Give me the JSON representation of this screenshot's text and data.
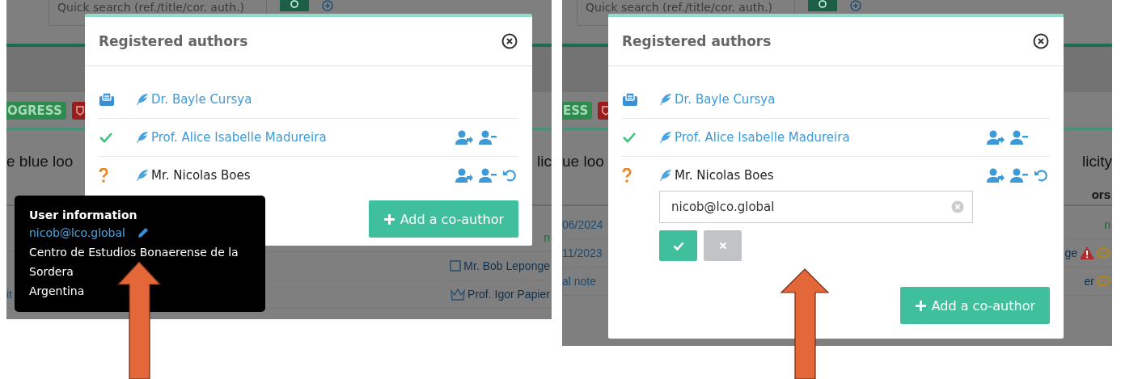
{
  "panels": [
    {
      "backdrop": {
        "search_placeholder": "Quick search (ref./title/cor. auth.)",
        "badges": [
          {
            "kind": "text",
            "text": "OGRESS",
            "color": "#2e8b4f"
          },
          {
            "kind": "icon",
            "color": "#9b1c1c"
          }
        ],
        "heading_left": "e blue loo",
        "heading_right": "lic",
        "rows": [
          {
            "right": "n",
            "kind": "green",
            "icons": []
          },
          {
            "right": "Mr. Bob Leponge",
            "kind": "link-square",
            "icons": []
          },
          {
            "left": "it",
            "right": "Prof. Igor Papier",
            "kind": "link-crown",
            "icons": []
          }
        ]
      },
      "modal": {
        "title": "Registered authors",
        "authors": [
          {
            "kind": "corresponding",
            "name": "Dr. Bayle Cursya",
            "registered": true
          },
          {
            "kind": "confirmed",
            "name": "Prof. Alice Isabelle Madureira",
            "registered": true,
            "actions": [
              {
                "kind": "reassign"
              },
              {
                "kind": "remove"
              }
            ]
          },
          {
            "kind": "pending",
            "name": "Mr. Nicolas Boes",
            "registered": false,
            "actions": [
              {
                "kind": "reassign"
              },
              {
                "kind": "remove"
              },
              {
                "kind": "reset"
              }
            ]
          }
        ],
        "add_button": "Add a co-author"
      },
      "tooltip": {
        "title": "User information",
        "email": "nicob@lco.global",
        "lines": [
          "Centro de Estudios Bonaerense de la Sordera",
          "Argentina"
        ]
      }
    },
    {
      "backdrop": {
        "search_placeholder": "Quick search (ref./title/cor. auth.)",
        "badges": [
          {
            "kind": "text",
            "text": "ESS",
            "color": "#2e8b4f"
          },
          {
            "kind": "icon",
            "color": "#9b1c1c"
          }
        ],
        "heading_left": "ue loo",
        "heading_right": "licity",
        "table_header_right": "ors",
        "rows": [
          {
            "left": "06/2024",
            "right": "n",
            "kind": "green",
            "icons": []
          },
          {
            "left": "11/2023",
            "right": "ge",
            "kind": "link",
            "icons": [
              {
                "kind": "warning"
              },
              {
                "kind": "comment"
              }
            ]
          },
          {
            "left": "al note",
            "right": "er",
            "kind": "link",
            "icons": [
              {
                "kind": "comment"
              }
            ]
          }
        ]
      },
      "modal": {
        "title": "Registered authors",
        "authors": [
          {
            "kind": "corresponding",
            "name": "Dr. Bayle Cursya",
            "registered": true
          },
          {
            "kind": "confirmed",
            "name": "Prof. Alice Isabelle Madureira",
            "registered": true,
            "actions": [
              {
                "kind": "reassign"
              },
              {
                "kind": "remove"
              }
            ]
          },
          {
            "kind": "pending",
            "name": "Mr. Nicolas Boes",
            "registered": false,
            "actions": [
              {
                "kind": "reassign"
              },
              {
                "kind": "remove"
              },
              {
                "kind": "reset"
              }
            ],
            "email_field": {
              "value": "nicob@lco.global"
            }
          }
        ],
        "add_button": "Add a co-author"
      }
    }
  ]
}
